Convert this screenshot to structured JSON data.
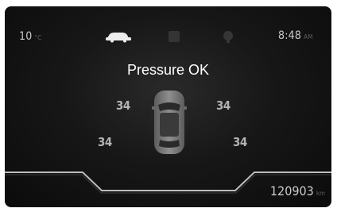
{
  "status_bar": {
    "temperature": "10",
    "temperature_unit": "°C",
    "time": "8:48",
    "time_unit": "AM",
    "icons": [
      "car-icon",
      "phone-icon",
      "navigation-icon"
    ]
  },
  "tpms": {
    "title": "Pressure OK",
    "front_left": "34",
    "front_right": "34",
    "rear_left": "34",
    "rear_right": "34"
  },
  "odometer": {
    "value": "120903",
    "unit": "km"
  },
  "colors": {
    "background": "#141414",
    "text_primary": "#ffffff",
    "text_secondary": "#c9c9c9",
    "pressure_text": "#b3b3b3",
    "car_body": "#7a7a7a"
  }
}
